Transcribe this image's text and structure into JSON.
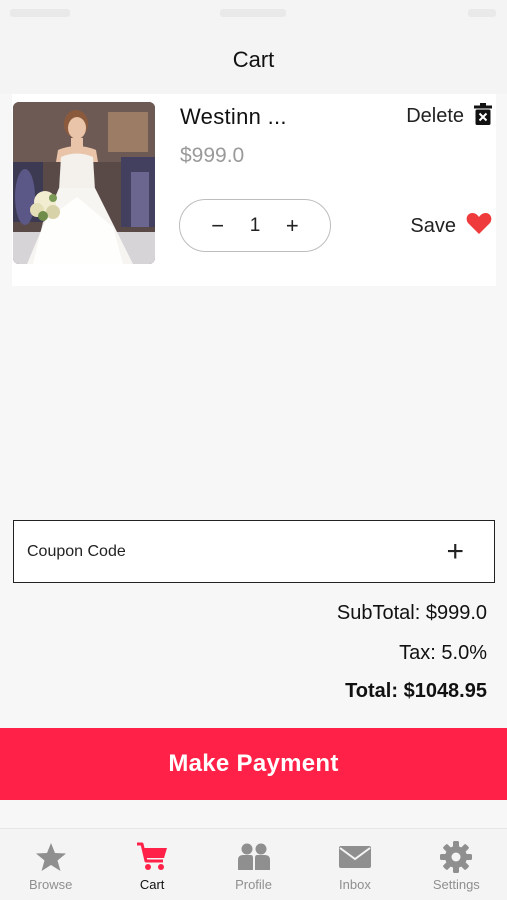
{
  "header": {
    "title": "Cart"
  },
  "cart": {
    "items": [
      {
        "name": "Westinn ...",
        "price": "$999.0",
        "quantity": "1",
        "delete_label": "Delete",
        "save_label": "Save",
        "decrement_label": "−",
        "increment_label": "+"
      }
    ]
  },
  "coupon": {
    "label": "Coupon Code",
    "add_label": "+"
  },
  "summary": {
    "subtotal": "SubTotal: $999.0",
    "tax": "Tax: 5.0%",
    "total": "Total: $1048.95"
  },
  "payment": {
    "label": "Make Payment"
  },
  "tabs": [
    {
      "label": "Browse",
      "icon": "star-icon",
      "active": false
    },
    {
      "label": "Cart",
      "icon": "shopping-cart-icon",
      "active": true
    },
    {
      "label": "Profile",
      "icon": "users-icon",
      "active": false
    },
    {
      "label": "Inbox",
      "icon": "envelope-icon",
      "active": false
    },
    {
      "label": "Settings",
      "icon": "gear-icon",
      "active": false
    }
  ],
  "colors": {
    "accent": "#ff2148",
    "heart": "#ef3b3b",
    "tab_inactive": "#8f8f8f",
    "price_gray": "#9a9a9a"
  }
}
